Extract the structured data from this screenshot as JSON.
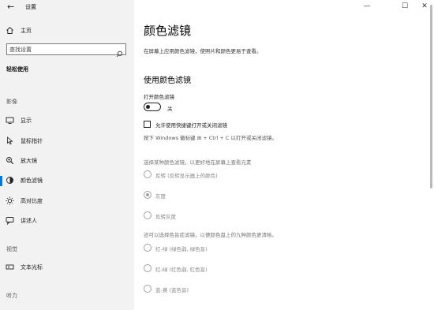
{
  "window": {
    "title": "设置",
    "back_glyph": "←",
    "controls": [
      "—",
      "☐",
      "✕"
    ]
  },
  "sidebar": {
    "home_label": "主页",
    "search": {
      "placeholder": "查找设置",
      "value": ""
    },
    "category_title": "轻松使用",
    "groups": {
      "vision": "影像",
      "interaction": "视觉",
      "hearing": "听力"
    },
    "items": [
      {
        "label": "显示",
        "icon": "display-icon"
      },
      {
        "label": "鼠标指针",
        "icon": "mouse-pointer-icon"
      },
      {
        "label": "放大镜",
        "icon": "magnifier-icon"
      },
      {
        "label": "颜色滤镜",
        "icon": "color-filter-icon",
        "active": true
      },
      {
        "label": "高对比度",
        "icon": "high-contrast-icon"
      },
      {
        "label": "讲述人",
        "icon": "narrator-icon"
      }
    ],
    "vision_items": [
      {
        "label": "文本光标",
        "icon": "text-cursor-icon"
      }
    ]
  },
  "main": {
    "title": "颜色滤镜",
    "description": "在屏幕上应用颜色滤镜，使照片和颜色更易于查看。",
    "section_title": "使用颜色滤镜",
    "toggle": {
      "label": "打开颜色滤镜",
      "state_text": "关",
      "on": false
    },
    "shortcut_checkbox": {
      "label": "允许使用快捷键打开或关闭滤镜",
      "checked": false
    },
    "shortcut_hint": "按下 Windows 徽标键 ⊞ + Ctrl + C 以打开或关闭滤镜。",
    "filter_prompt": "选择某种颜色滤镜，以更好地在屏幕上查看元素",
    "filters": [
      {
        "label": "反转 (反转显示器上的颜色)",
        "selected": false
      },
      {
        "label": "灰度",
        "selected": true
      },
      {
        "label": "反转灰度",
        "selected": false
      }
    ],
    "colorblind_prompt": "还可以选择色盲症滤镜，以便颜色盘上的九种颜色更清晰。",
    "colorblind_filters": [
      {
        "label": "红-绿 (绿色弱, 绿色盲)",
        "selected": false
      },
      {
        "label": "红-绿 (红色弱, 红色盲)",
        "selected": false
      },
      {
        "label": "蓝-黄 (蓝色盲)",
        "selected": false
      }
    ]
  },
  "colors": {
    "accent": "#0078d4",
    "sidebar_bg": "#f2f2f2",
    "main_bg": "#ffffff"
  }
}
